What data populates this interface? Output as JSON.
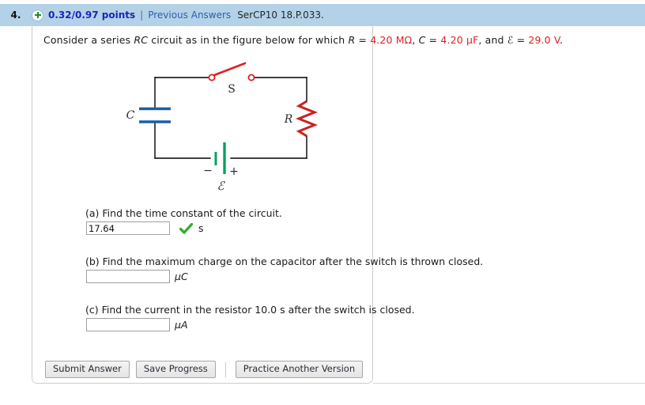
{
  "header": {
    "question_number": "4.",
    "plus_icon": "plus-circle-icon",
    "points": "0.32/0.97 points",
    "pipe": "|",
    "previous_answers": "Previous Answers",
    "question_code": "SerCP10 18.P.033.",
    "background_color": "#b4d2e7",
    "points_color": "#1a25b8",
    "link_color": "#2a5db0"
  },
  "prompt": {
    "seg1": "Consider a series ",
    "italic1": "RC",
    "seg2": " circuit as in the figure below for which ",
    "italic2": "R",
    "seg3": " = ",
    "value_R": "4.20 MΩ",
    "seg4": ", ",
    "italic3": "C",
    "seg5": " = ",
    "value_C": "4.20 μF",
    "seg6": ", and ",
    "italic4": "ℰ",
    "seg7": " = ",
    "value_E": "29.0 V",
    "seg8": ".",
    "value_color": "#e02020"
  },
  "figure": {
    "name": "rc-circuit-diagram",
    "labels": {
      "capacitor": "C",
      "resistor": "R",
      "switch": "S",
      "emf": "ℰ",
      "battery_minus": "−",
      "battery_plus": "+"
    },
    "colors": {
      "wire": "#000000",
      "capacitor": "#1a5fa8",
      "resistor": "#cc2222",
      "switch": "#e02020",
      "battery": "#0aa060"
    }
  },
  "parts": [
    {
      "label": "(a) Find the time constant of the circuit.",
      "value": "17.64",
      "placeholder": "",
      "unit": "s",
      "unit_italic": false,
      "correct": true,
      "check_icon": "green-check-icon"
    },
    {
      "label": "(b) Find the maximum charge on the capacitor after the switch is thrown closed.",
      "value": "",
      "placeholder": "",
      "unit": "μC",
      "unit_italic": true,
      "correct": false,
      "check_icon": ""
    },
    {
      "label": "(c) Find the current in the resistor 10.0 s after the switch is closed.",
      "value": "",
      "placeholder": "",
      "unit": "μA",
      "unit_italic": true,
      "correct": false,
      "check_icon": ""
    }
  ],
  "buttons": {
    "submit": "Submit Answer",
    "save": "Save Progress",
    "practice": "Practice Another Version"
  }
}
